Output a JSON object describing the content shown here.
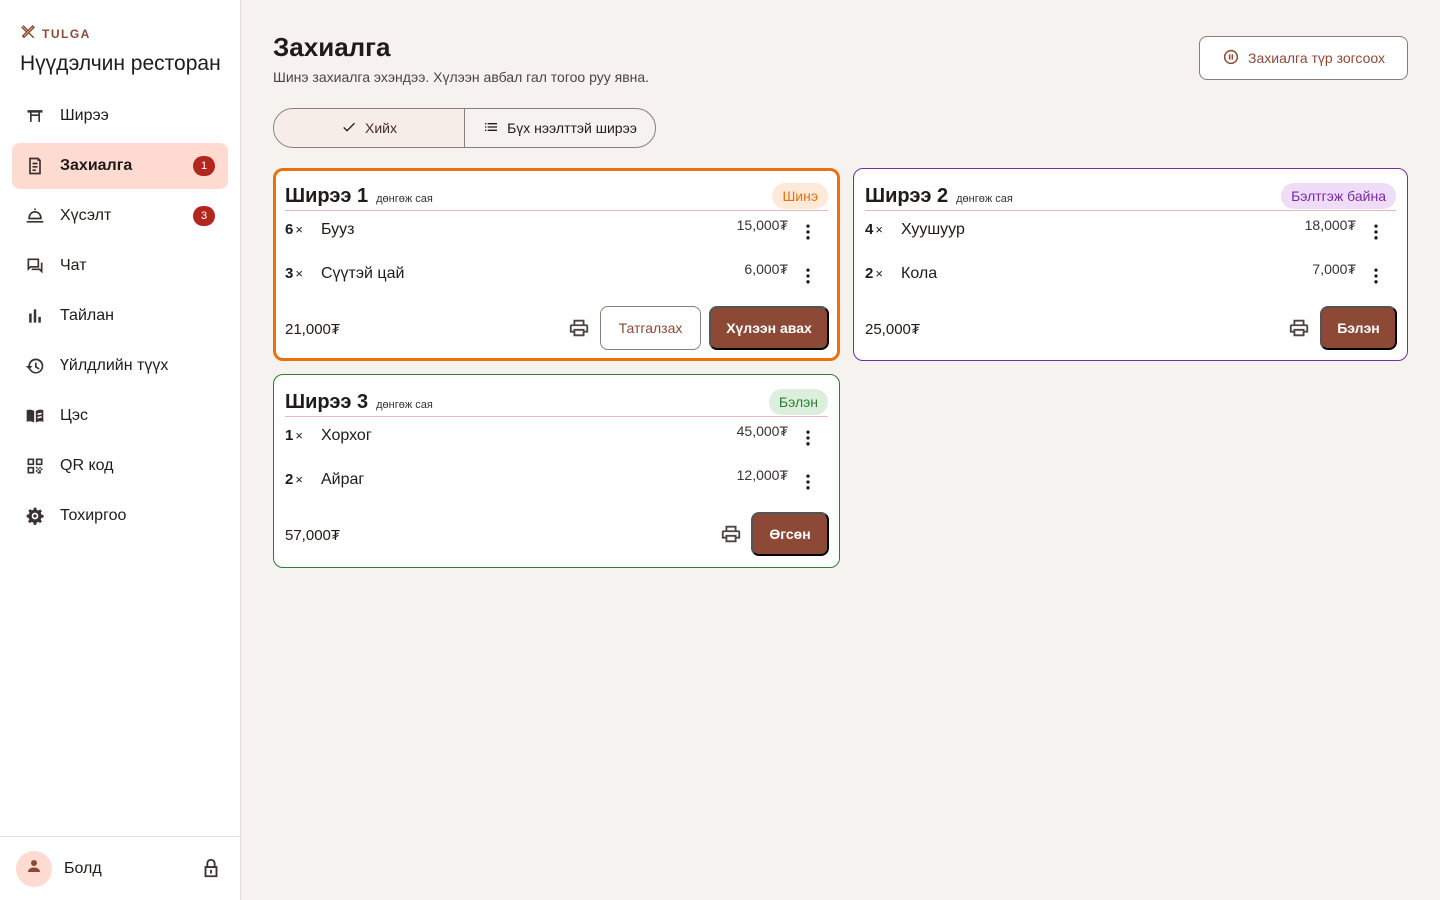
{
  "brand": {
    "name": "TULGA",
    "icon": "utensils-icon"
  },
  "app": {
    "title": "Нүүдэлчин ресторан"
  },
  "nav": {
    "items": [
      {
        "label": "Ширээ",
        "icon": "table-icon"
      },
      {
        "label": "Захиалга",
        "icon": "receipt-icon",
        "badge": "1",
        "active": true
      },
      {
        "label": "Хүсэлт",
        "icon": "bell-service-icon",
        "badge": "3"
      },
      {
        "label": "Чат",
        "icon": "chat-icon"
      },
      {
        "label": "Тайлан",
        "icon": "bar-chart-icon"
      },
      {
        "label": "Үйлдлийн түүх",
        "icon": "history-icon"
      },
      {
        "label": "Цэс",
        "icon": "menu-book-icon"
      },
      {
        "label": "QR код",
        "icon": "qr-code-icon"
      },
      {
        "label": "Тохиргоо",
        "icon": "gear-icon"
      }
    ]
  },
  "user": {
    "name": "Болд",
    "icon": "person-icon",
    "lock_icon": "lock-icon"
  },
  "header": {
    "title": "Захиалга",
    "subtitle": "Шинэ захиалга эхэндээ. Хүлээн авбал гал тогоо руу явна.",
    "pause_label": "Захиалга түр зогсоох",
    "pause_icon": "pause-circle-icon"
  },
  "filter": {
    "options": [
      {
        "label": "Хийх",
        "icon": "check-icon",
        "selected": true
      },
      {
        "label": "Бүх нээлттэй ширээ",
        "icon": "list-icon",
        "selected": false
      }
    ]
  },
  "colors": {
    "accent": "#8c4a36",
    "new": "#e8730e",
    "preparing": "#7b2aa2",
    "ready": "#2e7d32",
    "badge": "#b3261e"
  },
  "orders": [
    {
      "table": "Ширээ 1",
      "payment": "дөнгөж сая",
      "status": "Шинэ",
      "items": [
        {
          "qty": "6",
          "x": "×",
          "name": "Бууз",
          "price": "15,000₮"
        },
        {
          "qty": "3",
          "x": "×",
          "name": "Сүүтэй цай",
          "price": "6,000₮"
        }
      ],
      "total": "21,000₮",
      "reject_label": "Татгалзах",
      "primary_label": "Хүлээн авах"
    },
    {
      "table": "Ширээ 2",
      "payment": "дөнгөж сая",
      "status": "Бэлтгэж байна",
      "items": [
        {
          "qty": "4",
          "x": "×",
          "name": "Хуушуур",
          "price": "18,000₮"
        },
        {
          "qty": "2",
          "x": "×",
          "name": "Кола",
          "price": "7,000₮"
        }
      ],
      "total": "25,000₮",
      "primary_label": "Бэлэн"
    },
    {
      "table": "Ширээ 3",
      "payment": "дөнгөж сая",
      "status": "Бэлэн",
      "items": [
        {
          "qty": "1",
          "x": "×",
          "name": "Хорхог",
          "price": "45,000₮"
        },
        {
          "qty": "2",
          "x": "×",
          "name": "Айраг",
          "price": "12,000₮"
        }
      ],
      "total": "57,000₮",
      "primary_label": "Өгсөн"
    }
  ]
}
